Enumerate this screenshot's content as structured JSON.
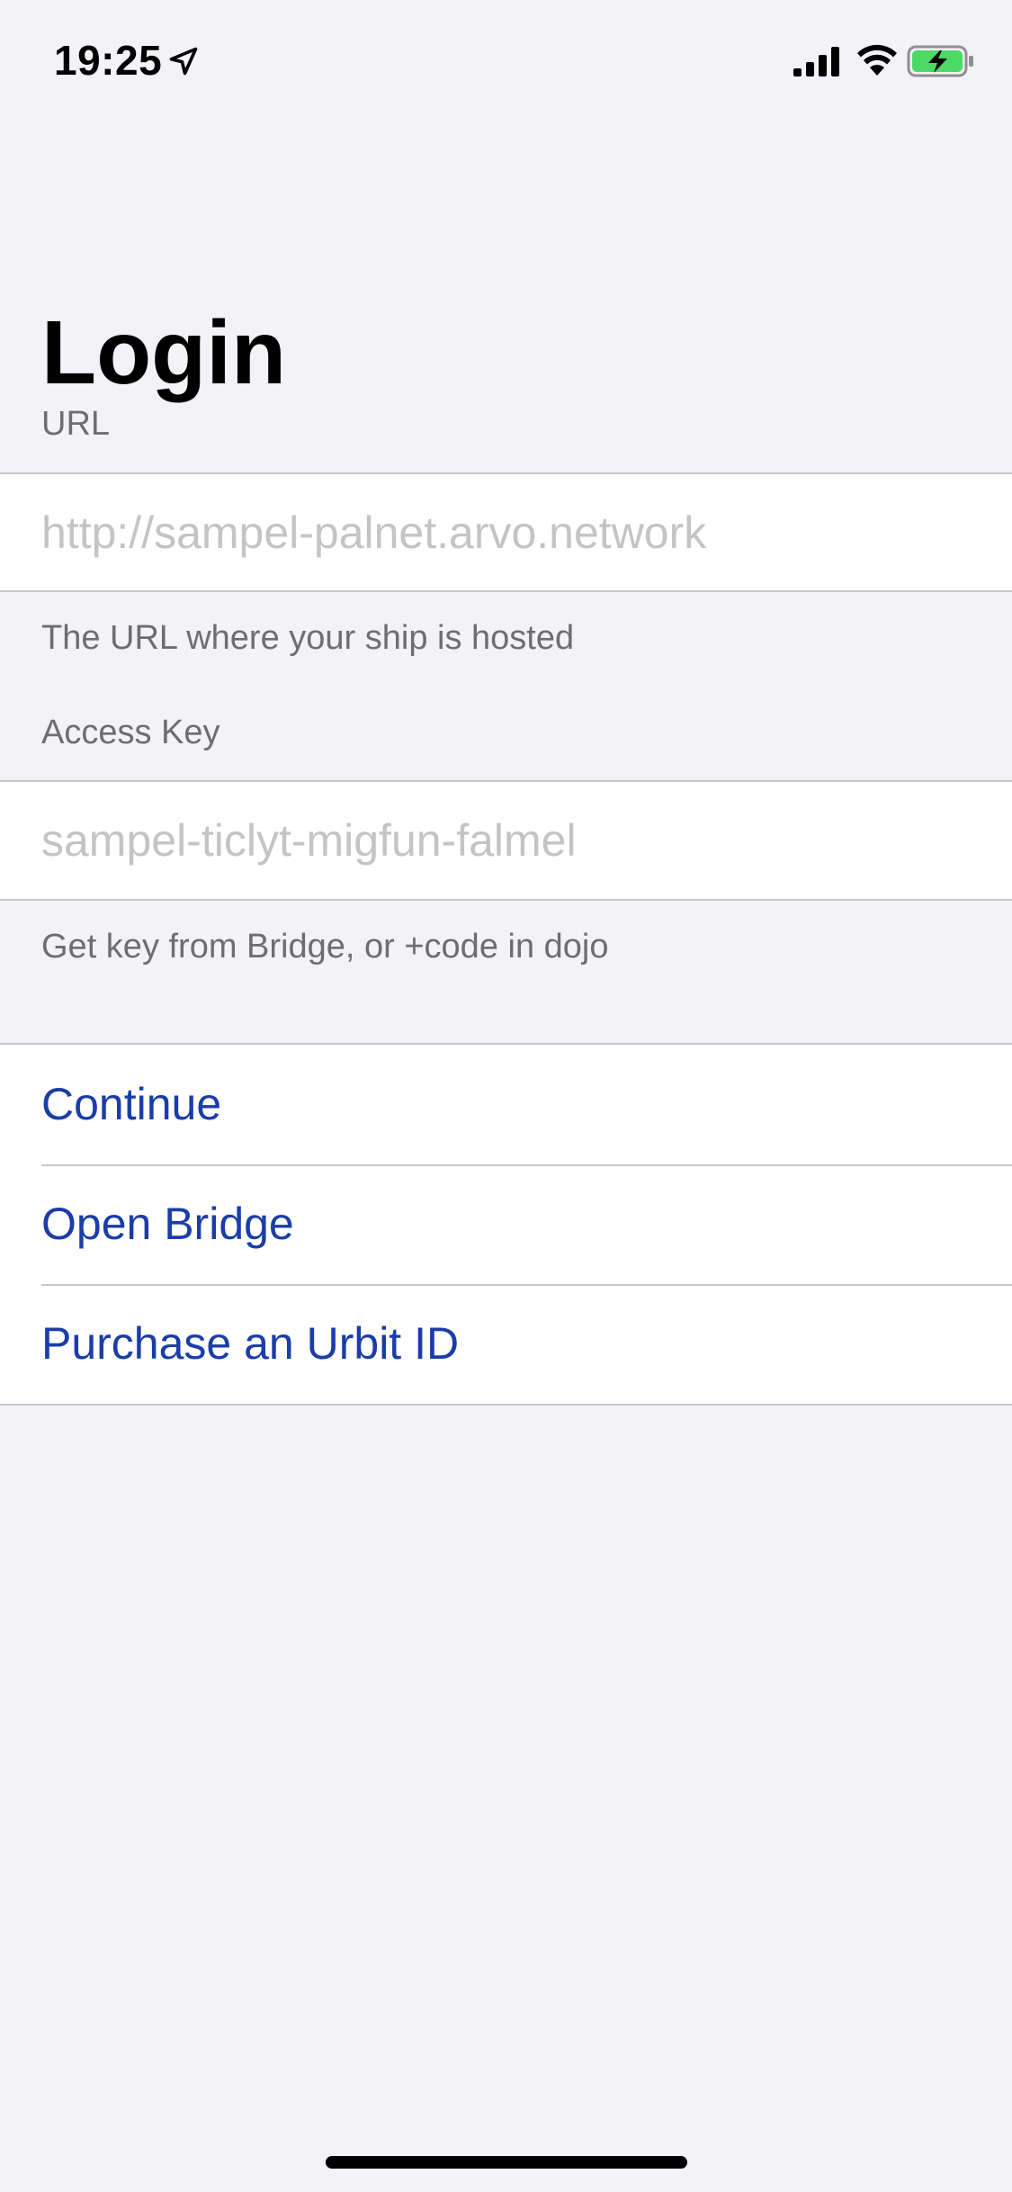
{
  "status_bar": {
    "time": "19:25",
    "icons": [
      "location-arrow-icon",
      "cellular-signal-icon",
      "wifi-icon",
      "battery-charging-icon"
    ],
    "battery_color": "#4cd964"
  },
  "page": {
    "title": "Login"
  },
  "url_section": {
    "header": "URL",
    "value": "",
    "placeholder": "http://sampel-palnet.arvo.network",
    "footer": "The URL where your ship is hosted"
  },
  "access_key_section": {
    "header": "Access Key",
    "value": "",
    "placeholder": "sampel-ticlyt-migfun-falmel",
    "footer": "Get key from Bridge, or +code in dojo"
  },
  "actions": {
    "continue_label": "Continue",
    "open_bridge_label": "Open Bridge",
    "purchase_label": "Purchase an Urbit ID"
  },
  "colors": {
    "background": "#f2f2f7",
    "action_text": "#1a3da8",
    "placeholder": "#c4c4c6",
    "secondary_text": "#6d6d72"
  }
}
